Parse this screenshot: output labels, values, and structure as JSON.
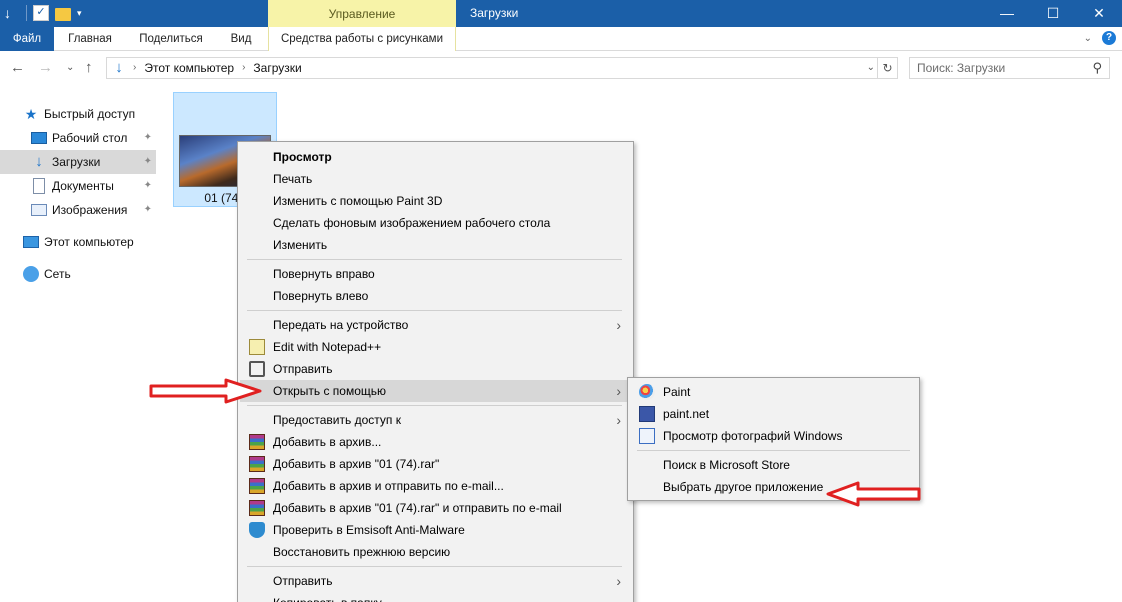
{
  "titlebar": {
    "context_tab": "Управление",
    "window_title": "Загрузки",
    "controls": [
      "—",
      "☐",
      "✕"
    ]
  },
  "ribbon": {
    "tabs": [
      "Файл",
      "Главная",
      "Поделиться",
      "Вид",
      "Средства работы с рисунками"
    ],
    "help": "?",
    "collapse": "⌄"
  },
  "address": {
    "crumbs": [
      "Этот компьютер",
      "Загрузки"
    ],
    "search_placeholder": "Поиск: Загрузки"
  },
  "nav": {
    "items": [
      {
        "label": "Быстрый доступ",
        "icon": "star-icon"
      },
      {
        "label": "Рабочий стол",
        "icon": "desktop-icon",
        "pinned": true
      },
      {
        "label": "Загрузки",
        "icon": "downloads-icon",
        "pinned": true,
        "selected": true
      },
      {
        "label": "Документы",
        "icon": "documents-icon",
        "pinned": true
      },
      {
        "label": "Изображения",
        "icon": "pictures-icon",
        "pinned": true
      },
      {
        "label": "Этот компьютер",
        "icon": "computer-icon"
      },
      {
        "label": "Сеть",
        "icon": "network-icon"
      }
    ],
    "pin_glyph": "📌"
  },
  "file": {
    "name": "01 (74)."
  },
  "context_menu": {
    "items": [
      {
        "label": "Просмотр",
        "bold": true
      },
      {
        "label": "Печать"
      },
      {
        "label": "Изменить с помощью Paint 3D"
      },
      {
        "label": "Сделать фоновым изображением рабочего стола"
      },
      {
        "label": "Изменить"
      },
      {
        "label": "Повернуть вправо"
      },
      {
        "label": "Повернуть влево"
      },
      {
        "label": "Передать на устройство",
        "submenu": true
      },
      {
        "label": "Edit with Notepad++",
        "icon": "notepadpp-icon"
      },
      {
        "label": "Отправить",
        "icon": "share-icon"
      },
      {
        "label": "Открыть с помощью",
        "submenu": true,
        "hover": true
      },
      {
        "label": "Предоставить доступ к",
        "submenu": true
      },
      {
        "label": "Добавить в архив...",
        "icon": "winrar-icon"
      },
      {
        "label": "Добавить в архив \"01 (74).rar\"",
        "icon": "winrar-icon"
      },
      {
        "label": "Добавить в архив и отправить по e-mail...",
        "icon": "winrar-icon"
      },
      {
        "label": "Добавить в архив \"01 (74).rar\" и отправить по e-mail",
        "icon": "winrar-icon"
      },
      {
        "label": "Проверить в Emsisoft Anti-Malware",
        "icon": "emsisoft-shield-icon"
      },
      {
        "label": "Восстановить прежнюю версию"
      },
      {
        "label": "Отправить",
        "submenu": true
      },
      {
        "label": "Копировать в папку"
      }
    ],
    "arrow_glyph": "›"
  },
  "open_with": {
    "items": [
      {
        "label": "Paint",
        "icon": "paint-icon"
      },
      {
        "label": "paint.net",
        "icon": "paintnet-icon"
      },
      {
        "label": "Просмотр фотографий Windows",
        "icon": "photo-viewer-icon"
      },
      {
        "label": "Поиск в Microsoft Store"
      },
      {
        "label": "Выбрать другое приложение"
      }
    ]
  },
  "colors": {
    "titlebar": "#1b5fa8",
    "manage_tab": "#f7f3a8",
    "selection": "#cce8ff",
    "annotation_arrow": "#e02020"
  }
}
